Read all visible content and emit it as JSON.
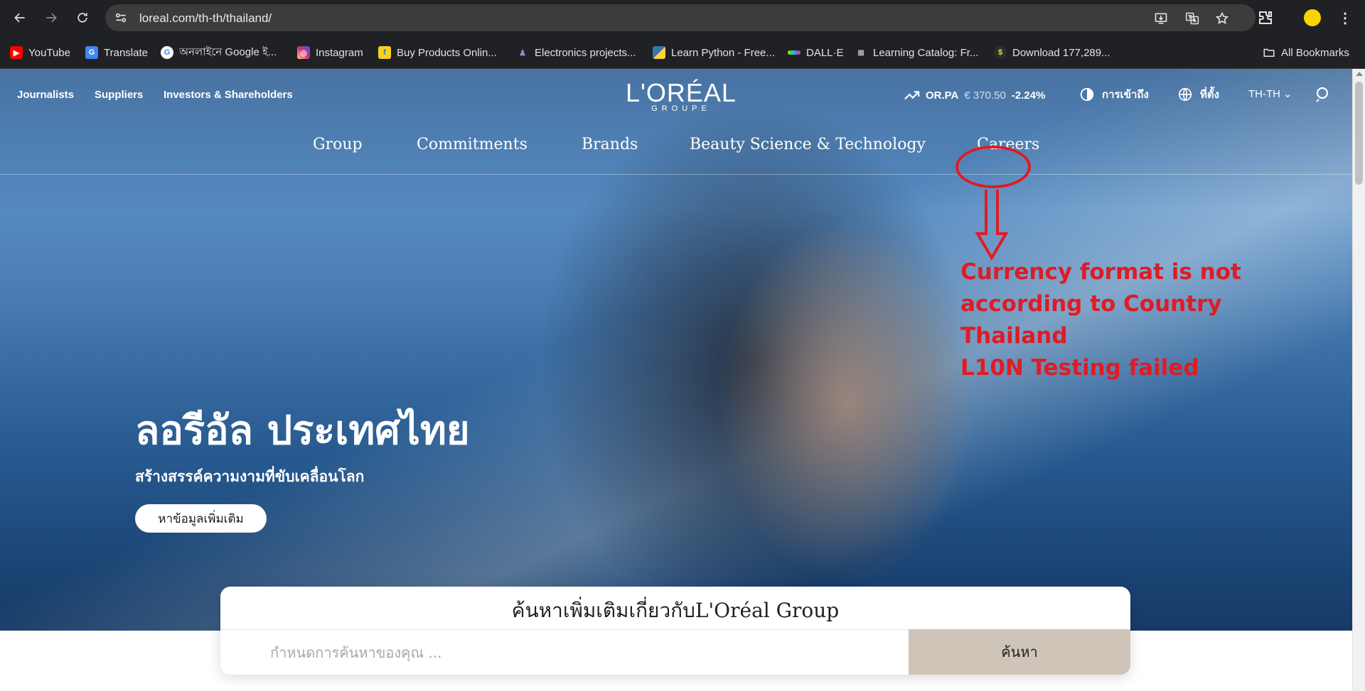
{
  "browser": {
    "url": "loreal.com/th-th/thailand/",
    "bookmarks": [
      {
        "label": "YouTube",
        "icon": "youtube-icon",
        "color": "#ff0000"
      },
      {
        "label": "Translate",
        "icon": "translate-icon",
        "color": "#4285f4"
      },
      {
        "label": "অনলাইনে Google ই...",
        "icon": "google-icon",
        "color": "#ffffff"
      },
      {
        "label": "Instagram",
        "icon": "instagram-icon",
        "color": "#d62976"
      },
      {
        "label": "Buy Products Onlin...",
        "icon": "flipkart-icon",
        "color": "#f7d21c"
      },
      {
        "label": "Electronics projects...",
        "icon": "robot-icon",
        "color": "#6b5ca5"
      },
      {
        "label": "Learn Python - Free...",
        "icon": "python-icon",
        "color": "#3776ab"
      },
      {
        "label": "DALL·E",
        "icon": "dalle-icon",
        "color": "#ffcc00"
      },
      {
        "label": "Learning Catalog: Fr...",
        "icon": "catalog-icon",
        "color": "#888888"
      },
      {
        "label": "Download 177,289...",
        "icon": "download-site-icon",
        "color": "#2d2d2d"
      }
    ],
    "all_bookmarks_label": "All Bookmarks"
  },
  "utility_nav": {
    "links": [
      "Journalists",
      "Suppliers",
      "Investors & Shareholders"
    ],
    "logo_main": "L'ORÉAL",
    "logo_sub": "GROUPE",
    "stock": {
      "ticker": "OR.PA",
      "price": "€ 370.50",
      "change": "-2.24%"
    },
    "accessibility_label": "การเข้าถึง",
    "location_label": "ที่ตั้ง",
    "language": "TH-TH"
  },
  "main_nav": [
    "Group",
    "Commitments",
    "Brands",
    "Beauty Science & Technology",
    "Careers"
  ],
  "hero": {
    "title": "ลอรีอัล ประเทศไทย",
    "subtitle": "สร้างสรรค์ความงามที่ขับเคลื่อนโลก",
    "cta_label": "หาข้อมูลเพิ่มเติม"
  },
  "search": {
    "heading": "ค้นหาเพิ่มเติมเกี่ยวกับL'Oréal Group",
    "placeholder": "กำหนดการค้นหาของคุณ ...",
    "submit_label": "ค้นหา"
  },
  "annotation": {
    "lines": [
      "Currency format is not",
      "according to Country",
      "Thailand",
      "L10N Testing failed"
    ],
    "color": "#e01b24"
  },
  "colors": {
    "chrome_bg": "#202124",
    "search_button": "#cfc4b8"
  }
}
